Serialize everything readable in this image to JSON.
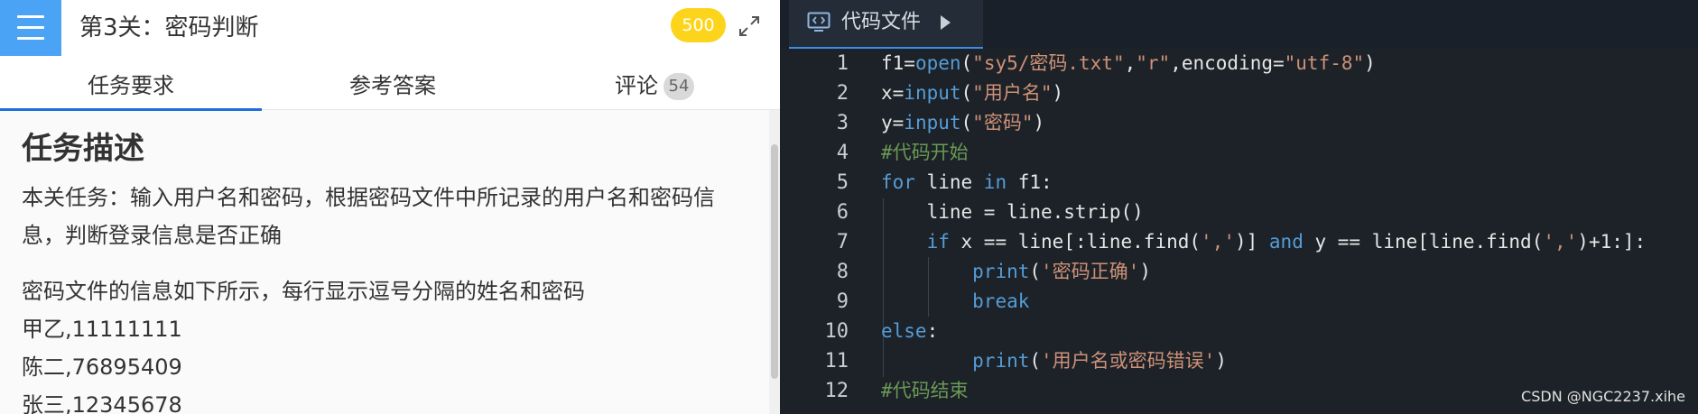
{
  "header": {
    "level_title": "第3关：密码判断",
    "score": "500"
  },
  "tabs": [
    {
      "label": "任务要求",
      "active": true
    },
    {
      "label": "参考答案",
      "active": false
    },
    {
      "label": "评论",
      "count": "54",
      "active": false
    }
  ],
  "task": {
    "section_title": "任务描述",
    "description_line1": "本关任务：输入用户名和密码，根据密码文件中所记录的用户名和密码信",
    "description_line2": "息，判断登录信息是否正确",
    "file_info_intro": "密码文件的信息如下所示，每行显示逗号分隔的姓名和密码",
    "records": [
      "甲乙,11111111",
      "陈二,76895409",
      "张三,12345678"
    ]
  },
  "editor": {
    "file_tab_label": "代码文件",
    "line_numbers": [
      "1",
      "2",
      "3",
      "4",
      "5",
      "6",
      "7",
      "8",
      "9",
      "10",
      "11",
      "12"
    ],
    "code": {
      "l1": {
        "a": "f1=",
        "b": "open",
        "c": "(",
        "d": "\"sy5/密码.txt\"",
        "e": ",",
        "f": "\"r\"",
        "g": ",encoding=",
        "h": "\"utf-8\"",
        "i": ")"
      },
      "l2": {
        "a": "x=",
        "b": "input",
        "c": "(",
        "d": "\"用户名\"",
        "e": ")"
      },
      "l3": {
        "a": "y=",
        "b": "input",
        "c": "(",
        "d": "\"密码\"",
        "e": ")"
      },
      "l4": "#代码开始",
      "l5": {
        "a": "for",
        "b": " line ",
        "c": "in",
        "d": " f1:"
      },
      "l6": "    line = line.strip()",
      "l7": {
        "a": "    ",
        "b": "if",
        "c": " x == line[:line.find(",
        "d": "','",
        "e": ")] ",
        "f": "and",
        "g": " y == line[line.find(",
        "h": "','",
        "i": ")+1:]:"
      },
      "l8": {
        "a": "        ",
        "b": "print",
        "c": "(",
        "d": "'密码正确'",
        "e": ")"
      },
      "l9": {
        "a": "        ",
        "b": "break"
      },
      "l10": {
        "a": "else",
        "b": ":"
      },
      "l11": {
        "a": "        ",
        "b": "print",
        "c": "(",
        "d": "'用户名或密码错误'",
        "e": ")"
      },
      "l12": "#代码结束"
    }
  },
  "watermark": "CSDN @NGC2237.xihe"
}
